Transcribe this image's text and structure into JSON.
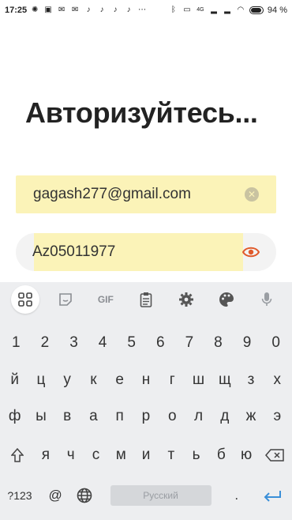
{
  "status_bar": {
    "time": "17:25",
    "net_label": "4G",
    "battery_percent": "94 %",
    "icons_left": [
      "notification-dot-icon",
      "message-icon",
      "mail-icon",
      "mail-icon",
      "tiktok-icon",
      "tiktok-icon",
      "tiktok-icon",
      "tiktok-icon",
      "more-dots-icon"
    ],
    "icons_right": [
      "bluetooth-icon",
      "vibrate-icon",
      "signal-icon",
      "signal-icon",
      "wifi-icon",
      "battery-icon"
    ]
  },
  "screen": {
    "title": "Авторизуйтесь..."
  },
  "login": {
    "email_value": "gagash277@gmail.com",
    "password_value": "Az05011977"
  },
  "keyboard": {
    "toolbar": {
      "gif_label": "GIF",
      "items": [
        "apps-icon",
        "sticker-icon",
        "gif",
        "clipboard-icon",
        "settings-icon",
        "palette-icon",
        "mic-icon"
      ]
    },
    "row1": [
      "1",
      "2",
      "3",
      "4",
      "5",
      "6",
      "7",
      "8",
      "9",
      "0"
    ],
    "row2": [
      "й",
      "ц",
      "у",
      "к",
      "е",
      "н",
      "г",
      "ш",
      "щ",
      "з",
      "х"
    ],
    "row3": [
      "ф",
      "ы",
      "в",
      "а",
      "п",
      "р",
      "о",
      "л",
      "д",
      "ж",
      "э"
    ],
    "row4": [
      "я",
      "ч",
      "с",
      "м",
      "и",
      "т",
      "ь",
      "б",
      "ю"
    ],
    "bottom": {
      "symbols_label": "?123",
      "at_label": "@",
      "space_label": "Русский",
      "period_label": "."
    }
  },
  "colors": {
    "field_highlight": "#fbf3b8",
    "eye_icon": "#e05a2b",
    "enter_key": "#3a8fd8",
    "keyboard_bg": "#edeef0"
  }
}
